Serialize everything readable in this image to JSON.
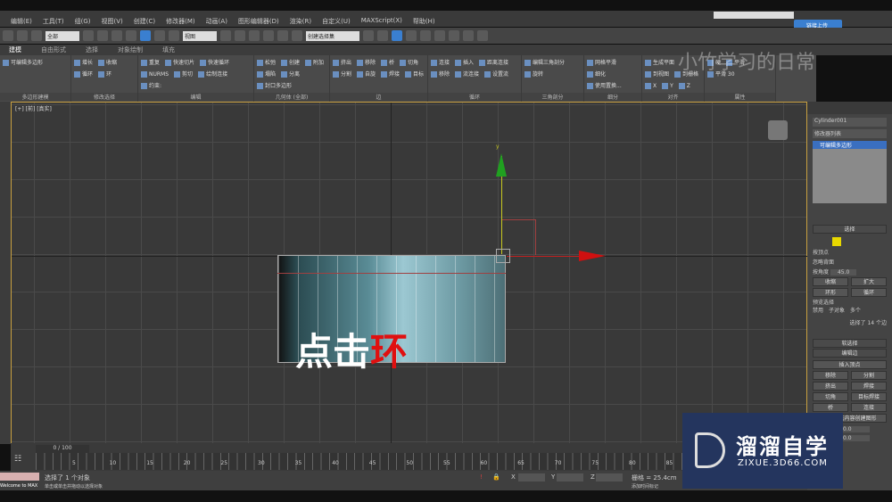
{
  "menu": [
    "编辑(E)",
    "工具(T)",
    "组(G)",
    "视图(V)",
    "创建(C)",
    "修改器(M)",
    "动画(A)",
    "图形编辑器(D)",
    "渲染(R)",
    "自定义(U)",
    "MAXScript(X)",
    "帮助(H)"
  ],
  "toolbar": {
    "filter": "全部",
    "ref_coord": "视图",
    "selection_set": "创建选择集",
    "upload_button": "链接上传"
  },
  "ribbon_tabs": [
    "建模",
    "自由形式",
    "选择",
    "对象绘制",
    "填充"
  ],
  "ribbon_groups": [
    {
      "label": "多边形建模",
      "items": [
        "可编辑多边形"
      ]
    },
    {
      "label": "修改选择",
      "items": [
        "增长",
        "收缩",
        "循环",
        "环"
      ]
    },
    {
      "label": "编辑",
      "items": [
        "重复",
        "快速切片",
        "快速循环",
        "NURMS",
        "剪切",
        "绘制连接",
        "约束:"
      ]
    },
    {
      "label": "几何体 (全部)",
      "items": [
        "松弛",
        "创建",
        "附加",
        "塌陷",
        "分离",
        "封口多边形"
      ]
    },
    {
      "label": "边",
      "items": [
        "挤出",
        "移除",
        "桥",
        "切角",
        "分割",
        "自旋",
        "焊接",
        "目标"
      ]
    },
    {
      "label": "循环",
      "items": [
        "连接",
        "插入",
        "距离连接",
        "移除",
        "流连接",
        "设置流"
      ]
    },
    {
      "label": "三角剖分",
      "items": [
        "编辑三角剖分",
        "旋转"
      ]
    },
    {
      "label": "细分",
      "items": [
        "网格平滑",
        "细化",
        "使用置换..."
      ]
    },
    {
      "label": "对齐",
      "items": [
        "生成平面",
        "到视图",
        "到栅格",
        "X",
        "Y",
        "Z"
      ]
    },
    {
      "label": "属性",
      "items": [
        "硬",
        "平滑",
        "平滑 30"
      ]
    }
  ],
  "watermark": "小竹学习的日常",
  "viewport": {
    "label": "[+] [前] [真实]",
    "overlay_white": "点击",
    "overlay_red": "环",
    "axis_y": "y"
  },
  "command_panel": {
    "object_name": "Cylinder001",
    "modifier_list": "修改器列表",
    "stack_item": "可编辑多边形",
    "selection_title": "选择",
    "by_vertex": "按顶点",
    "ignore_backfacing": "忽略背面",
    "by_angle": "按角度",
    "angle_value": "45.0",
    "shrink": "收缩",
    "grow": "扩大",
    "ring": "环形",
    "loop": "循环",
    "preview_title": "预览选择",
    "preview_options": [
      "禁用",
      "子对象",
      "多个"
    ],
    "selected_info": "选择了 14 个边",
    "soft_selection": "软选择",
    "edit_edges": "编辑边",
    "insert_vertex": "插入顶点",
    "buttons": [
      "移除",
      "分割",
      "挤出",
      "焊接",
      "切角",
      "目标焊接",
      "桥",
      "连接"
    ],
    "create_shape": "利用所选内容创建图形",
    "spinner1": "0.0",
    "spinner2": "0.0"
  },
  "timeline": {
    "frame": "0 / 100",
    "ticks": [
      "5",
      "10",
      "15",
      "20",
      "25",
      "30",
      "35",
      "40",
      "45",
      "50",
      "55",
      "60",
      "65",
      "70",
      "75",
      "80",
      "85"
    ]
  },
  "status": {
    "selected": "选择了 1 个对象",
    "prompt": "单击或单击并拖动以选择对象",
    "listener": "Welcome to MAX",
    "x_label": "X",
    "y_label": "Y",
    "z_label": "Z",
    "grid": "栅格 = 25.4cm",
    "add_time_tag": "添加时间标记"
  },
  "logo": {
    "name": "溜溜自学",
    "url": "ZIXUE.3D66.COM"
  },
  "colors": {
    "accent": "#3a7fd0",
    "y_axis": "#20a020",
    "x_axis": "#d01010",
    "logo_bg": "#24355e"
  }
}
